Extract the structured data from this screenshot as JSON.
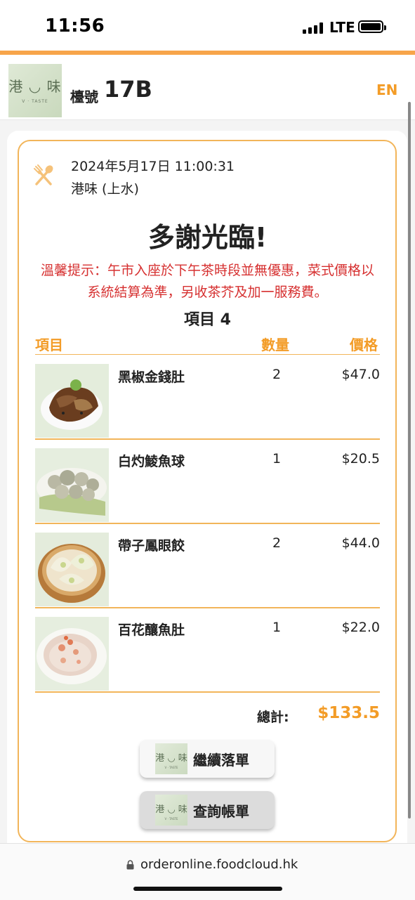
{
  "status_bar": {
    "time": "11:56",
    "network": "LTE"
  },
  "header": {
    "table_label": "檯號",
    "table_number": "17B",
    "language_toggle": "EN"
  },
  "logo": {
    "main_text": "港 ◡ 味",
    "sub_text": "V · TASTE"
  },
  "order": {
    "datetime": "2024年5月17日 11:00:31",
    "shop": "港味 (上水)",
    "thanks": "多謝光臨!",
    "notice": "溫馨提示：午市入座於下午茶時段並無優惠，菜式價格以系統結算為準，另收茶芥及加一服務費。",
    "item_count_label": "項目 4"
  },
  "table_headers": {
    "item": "項目",
    "qty": "數量",
    "price": "價格"
  },
  "items": [
    {
      "name": "黑椒金錢肚",
      "qty": "2",
      "price": "$47.0"
    },
    {
      "name": "白灼鯪魚球",
      "qty": "1",
      "price": "$20.5"
    },
    {
      "name": "帶子鳳眼餃",
      "qty": "2",
      "price": "$44.0"
    },
    {
      "name": "百花釀魚肚",
      "qty": "1",
      "price": "$22.0"
    }
  ],
  "total": {
    "label": "總計:",
    "value": "$133.5"
  },
  "buttons": {
    "continue_order": "繼續落單",
    "view_bill": "查詢帳單"
  },
  "browser": {
    "url": "orderonline.foodcloud.hk"
  },
  "colors": {
    "accent": "#f39c27",
    "border": "#f2b55a",
    "notice": "#d63030"
  }
}
